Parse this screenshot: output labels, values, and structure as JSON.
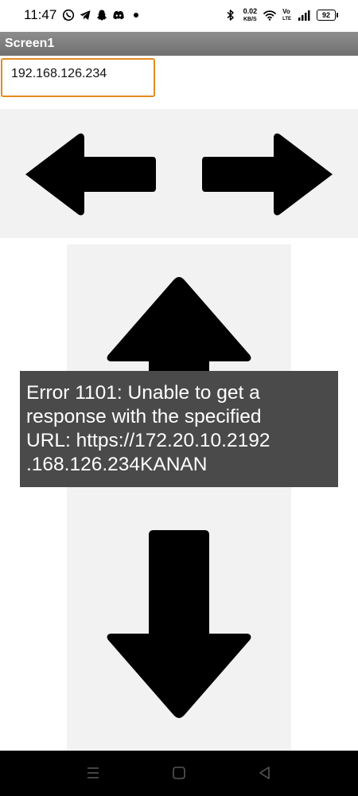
{
  "status_bar": {
    "time": "11:47",
    "net_speed_value": "0.02",
    "net_speed_unit": "KB/S",
    "volte_top": "Vo",
    "volte_bottom": "LTE",
    "battery": "92",
    "left_icons": [
      "whatsapp-icon",
      "telegram-icon",
      "snapchat-icon",
      "discord-icon",
      "dot-icon"
    ],
    "right_icons": [
      "bluetooth-icon",
      "wifi-icon",
      "signal-icon",
      "battery-icon"
    ]
  },
  "app": {
    "title": "Screen1"
  },
  "ip_input": {
    "value": "192.168.126.234"
  },
  "controls": {
    "left": "arrow-left-icon",
    "right": "arrow-right-icon",
    "up": "arrow-up-icon",
    "down": "arrow-down-icon"
  },
  "toast": {
    "message": "Error 1101: Unable to get a response with the specified URL: https://172.20.10.2192.168.126.234KANAN",
    "lines": [
      "Error 1101: Unable to get a",
      "response with the specified",
      "URL: https://172.20.10.2192",
      ".168.126.234KANAN"
    ]
  },
  "nav_bar": {
    "buttons": [
      "menu-icon",
      "home-icon",
      "back-icon"
    ]
  },
  "colors": {
    "title_bar": "#7f7f7f",
    "input_border": "#e58a1f",
    "panel": "#f2f2f2",
    "toast": "#4a4a4a",
    "arrow": "#000000"
  }
}
